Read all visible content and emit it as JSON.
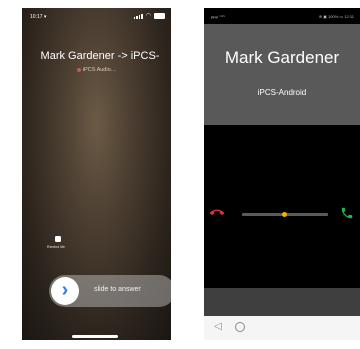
{
  "ios": {
    "status": {
      "time": "10:17 ▾"
    },
    "caller": "Mark Gardener -> iPCS-",
    "subtitle": "iPCS Audio…",
    "remind_label": "Remind Me",
    "slide_label": "slide to answer"
  },
  "android": {
    "status": {
      "left": "µ‌µ‌µ ⁺‌ᶜ‌ᶠ‌ˢ",
      "right": "⊕ ▣ 100% ▭ 12:11"
    },
    "caller": "Mark Gardener",
    "subtitle": "iPCS-Android",
    "nav": {
      "back": "◁",
      "home": "○"
    },
    "colors": {
      "decline": "#e0303a",
      "accept": "#22b34a",
      "slider_handle": "#f0b400"
    }
  }
}
